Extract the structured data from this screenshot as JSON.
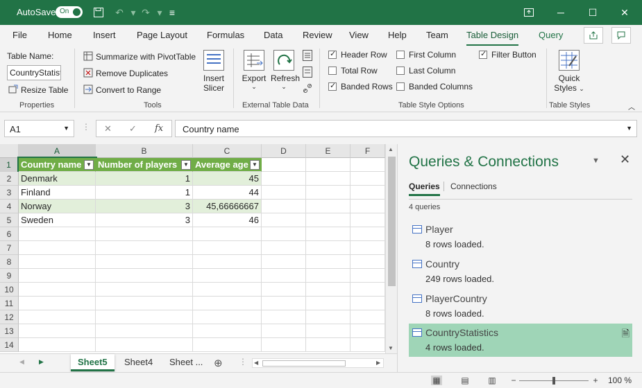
{
  "titlebar": {
    "autosave_label": "AutoSave",
    "autosave_state": "On",
    "accent_color": "#217346"
  },
  "ribbon_tabs": [
    "File",
    "Home",
    "Insert",
    "Page Layout",
    "Formulas",
    "Data",
    "Review",
    "View",
    "Help",
    "Team",
    "Table Design",
    "Query"
  ],
  "active_tab": "Table Design",
  "properties": {
    "table_name_label": "Table Name:",
    "table_name_value": "CountryStatistics",
    "resize": "Resize Table",
    "group": "Properties"
  },
  "tools": {
    "summarize": "Summarize with PivotTable",
    "remove_dupes": "Remove Duplicates",
    "convert": "Convert to Range",
    "insert_slicer_1": "Insert",
    "insert_slicer_2": "Slicer",
    "group": "Tools"
  },
  "external": {
    "export": "Export",
    "refresh": "Refresh",
    "group": "External Table Data"
  },
  "style_options": {
    "header_row": "Header Row",
    "total_row": "Total Row",
    "banded_rows": "Banded Rows",
    "first_column": "First Column",
    "last_column": "Last Column",
    "banded_columns": "Banded Columns",
    "filter_button": "Filter Button",
    "group": "Table Style Options"
  },
  "table_styles": {
    "quick_1": "Quick",
    "quick_2": "Styles",
    "group": "Table Styles"
  },
  "formula_bar": {
    "name_box": "A1",
    "fx": "fx",
    "formula": "Country name"
  },
  "grid": {
    "columns": [
      "A",
      "B",
      "C",
      "D",
      "E",
      "F"
    ],
    "rows": [
      "1",
      "2",
      "3",
      "4",
      "5",
      "6",
      "7",
      "8",
      "9",
      "10",
      "11",
      "12",
      "13",
      "14"
    ],
    "headers": [
      "Country name",
      "Number of players",
      "Average age"
    ],
    "data": [
      [
        "Denmark",
        "1",
        "45"
      ],
      [
        "Finland",
        "1",
        "44"
      ],
      [
        "Norway",
        "3",
        "45,66666667"
      ],
      [
        "Sweden",
        "3",
        "46"
      ]
    ]
  },
  "sheets": {
    "tabs": [
      "Sheet5",
      "Sheet4",
      "Sheet ..."
    ],
    "active": "Sheet5"
  },
  "status": {
    "zoom": "100 %"
  },
  "queries_pane": {
    "title": "Queries & Connections",
    "tab_queries": "Queries",
    "tab_connections": "Connections",
    "count": "4 queries",
    "items": [
      {
        "name": "Player",
        "status": "8 rows loaded."
      },
      {
        "name": "Country",
        "status": "249 rows loaded."
      },
      {
        "name": "PlayerCountry",
        "status": "8 rows loaded."
      },
      {
        "name": "CountryStatistics",
        "status": "4 rows loaded."
      }
    ],
    "selected_color": "#9fd5b7"
  }
}
